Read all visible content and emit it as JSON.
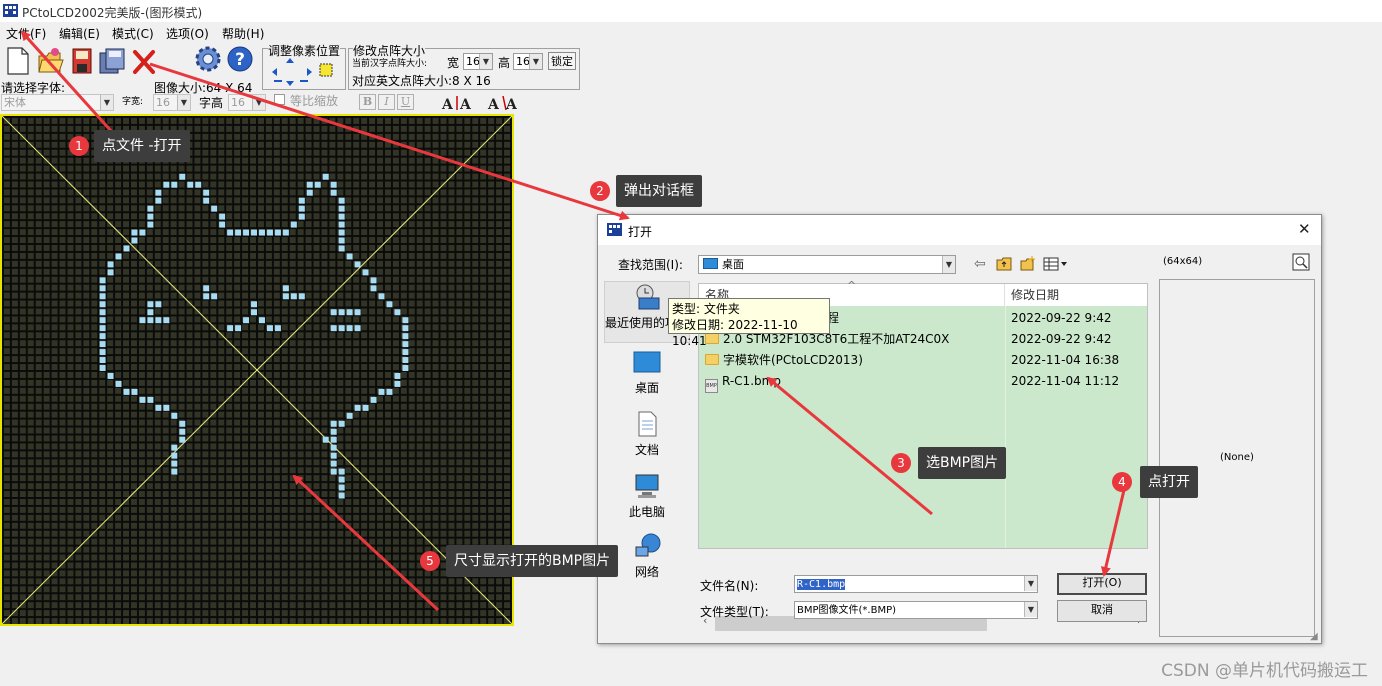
{
  "app": {
    "title": "PCtoLCD2002完美版-(图形模式)"
  },
  "menu": [
    "文件(F)",
    "编辑(E)",
    "模式(C)",
    "选项(O)",
    "帮助(H)"
  ],
  "toolbar": {
    "adjust_pixel_label": "调整像素位置",
    "modify_matrix_label": "修改点阵大小",
    "current_matrix_note": "当前汉字点阵大小:",
    "width_label": "宽",
    "width_value": "16",
    "height_label": "高",
    "height_value": "16",
    "lock_label": "锁定",
    "english_matrix_label": "对应英文点阵大小:8 X 16",
    "select_font_label": "请选择字体:",
    "font_value": "宋体",
    "char_width_label": "字宽:",
    "char_width_value": "16",
    "image_size_label": "图像大小:64 X 64",
    "char_height_label": "字高",
    "char_height_value": "16",
    "proportional_label": "等比缩放",
    "bold_label": "B",
    "italic_label": "I",
    "underline_label": "U"
  },
  "dialog": {
    "title": "打开",
    "look_in_label": "查找范围(I):",
    "look_in_value": "桌面",
    "preview_size": "(64x64)",
    "preview_none": "(None)",
    "places": [
      "最近使用的项目",
      "桌面",
      "文档",
      "此电脑",
      "网络"
    ],
    "columns": [
      "名称",
      "修改日期"
    ],
    "files": [
      {
        "name": "程",
        "date": "2022-09-22 9:42",
        "type": "folder"
      },
      {
        "name": "2.0 STM32F103C8T6工程不加AT24C0X",
        "date": "2022-09-22 9:42",
        "type": "folder"
      },
      {
        "name": "字模软件(PCtoLCD2013)",
        "date": "2022-11-04 16:38",
        "type": "folder"
      },
      {
        "name": "R-C1.bmp",
        "date": "2022-11-04 11:12",
        "type": "bmp"
      }
    ],
    "tooltip_type": "类型: 文件夹",
    "tooltip_date": "修改日期: 2022-11-10 10:41",
    "filename_label": "文件名(N):",
    "filename_value": "R-C1.bmp",
    "filetype_label": "文件类型(T):",
    "filetype_value": "BMP图像文件(*.BMP)",
    "open_button": "打开(O)",
    "cancel_button": "取消",
    "close_glyph": "✕"
  },
  "annotations": [
    {
      "num": "1",
      "text": "点文件 -打开"
    },
    {
      "num": "2",
      "text": "弹出对话框"
    },
    {
      "num": "3",
      "text": "选BMP图片"
    },
    {
      "num": "4",
      "text": "点打开"
    },
    {
      "num": "5",
      "text": "尺寸显示打开的BMP图片"
    }
  ],
  "watermark": "CSDN @单片机代码搬运工",
  "colors": {
    "grid_bg": "#323525",
    "pixel_on": "#a8dcf2",
    "border_yellow": "#e6e600",
    "annotation_red": "#e8383d",
    "callout_bg": "#3d3d3d",
    "list_selected_bg": "#cce8cc"
  }
}
